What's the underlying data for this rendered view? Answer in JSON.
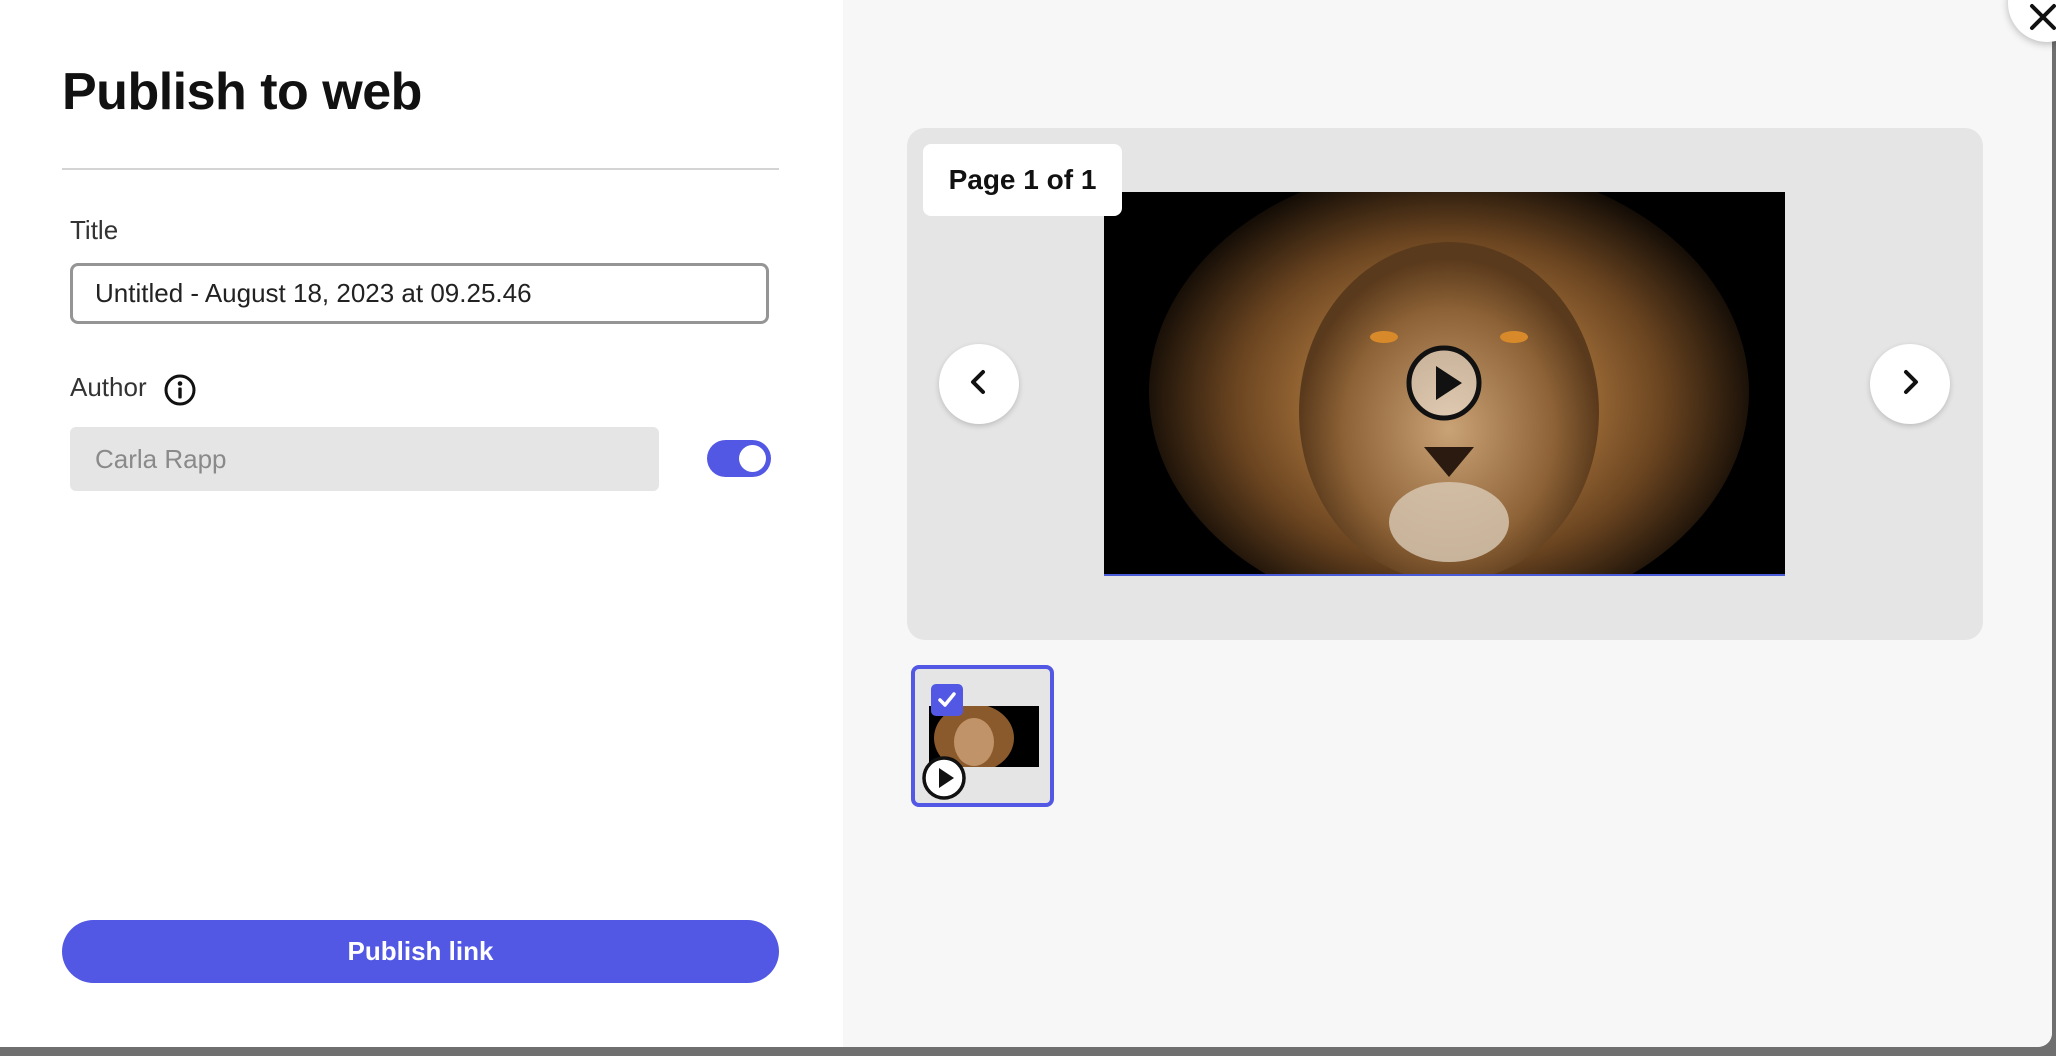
{
  "dialog": {
    "title": "Publish to web"
  },
  "form": {
    "title_label": "Title",
    "title_value": "Untitled - August 18, 2023 at 09.25.46",
    "author_label": "Author",
    "author_value": "Carla Rapp",
    "author_toggle_on": true,
    "publish_label": "Publish link"
  },
  "preview": {
    "page_indicator": "Page 1 of 1",
    "thumbnail_selected": true
  },
  "icons": {
    "info": "info-icon",
    "prev": "chevron-left-icon",
    "next": "chevron-right-icon",
    "play": "play-icon",
    "check": "checkmark-icon",
    "close": "close-icon"
  },
  "colors": {
    "accent": "#5258e4",
    "panel_bg": "#f7f7f7",
    "card_bg": "#e5e5e5"
  }
}
